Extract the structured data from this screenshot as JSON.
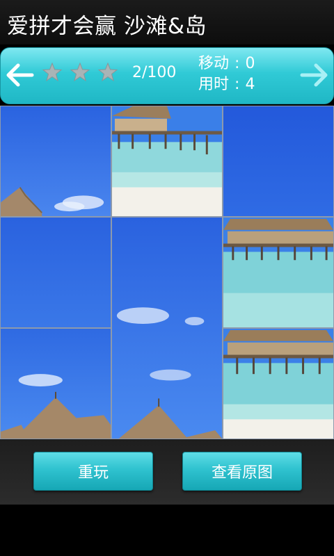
{
  "header": {
    "title": "爱拼才会赢 沙滩&岛"
  },
  "toolbar": {
    "prev_icon": "left-arrow-icon",
    "next_icon": "right-arrow-icon",
    "star_rating": {
      "filled": 0,
      "total": 3
    },
    "level_text": "2/100",
    "moves_label": "移动",
    "moves_separator": ":",
    "moves_value": "0",
    "time_label": "用时",
    "time_separator": ":",
    "time_value": "4"
  },
  "puzzle": {
    "grid": "3x3",
    "image": "beach-hut-over-water-photo"
  },
  "actions": {
    "replay_label": "重玩",
    "view_original_label": "查看原图"
  },
  "colors": {
    "accent": "#30cad6",
    "sky": "#2f6fe6",
    "sea": "#8fd8dc",
    "sand": "#f3f1ea"
  }
}
